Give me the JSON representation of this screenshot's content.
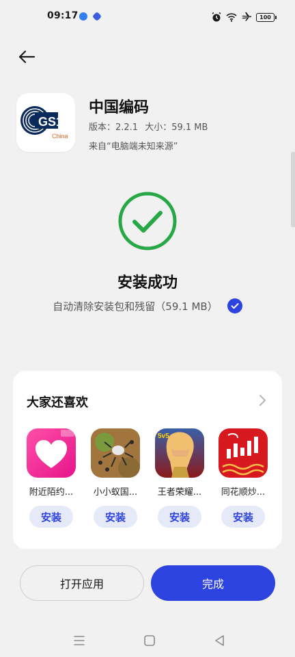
{
  "status_bar": {
    "time": "09:17",
    "battery": "100",
    "icons": [
      "alarm-icon",
      "wifi-icon",
      "airplane-icon",
      "battery-icon"
    ]
  },
  "app": {
    "name": "中国编码",
    "version_label": "版本：2.2.1",
    "size_label": "大小：59.1 MB",
    "source": "来自“电脑端未知来源”",
    "logo_text": "GS1",
    "logo_sub": "China"
  },
  "result": {
    "title": "安装成功",
    "cleanup_text": "自动清除安装包和残留（59.1 MB）",
    "cleanup_checked": true
  },
  "recommend": {
    "title": "大家还喜欢",
    "apps": [
      {
        "name": "附近陌约...",
        "install_label": "安装",
        "icon": "heart-app-icon"
      },
      {
        "name": "小小蚁国...",
        "install_label": "安装",
        "icon": "ant-game-icon"
      },
      {
        "name": "王者荣耀...",
        "install_label": "安装",
        "icon": "hero-game-icon"
      },
      {
        "name": "同花顺炒...",
        "install_label": "安装",
        "icon": "stock-app-icon"
      }
    ]
  },
  "buttons": {
    "open": "打开应用",
    "done": "完成"
  },
  "colors": {
    "accent": "#2d43e0",
    "success_green": "#27a745",
    "background": "#f1f1f1"
  }
}
